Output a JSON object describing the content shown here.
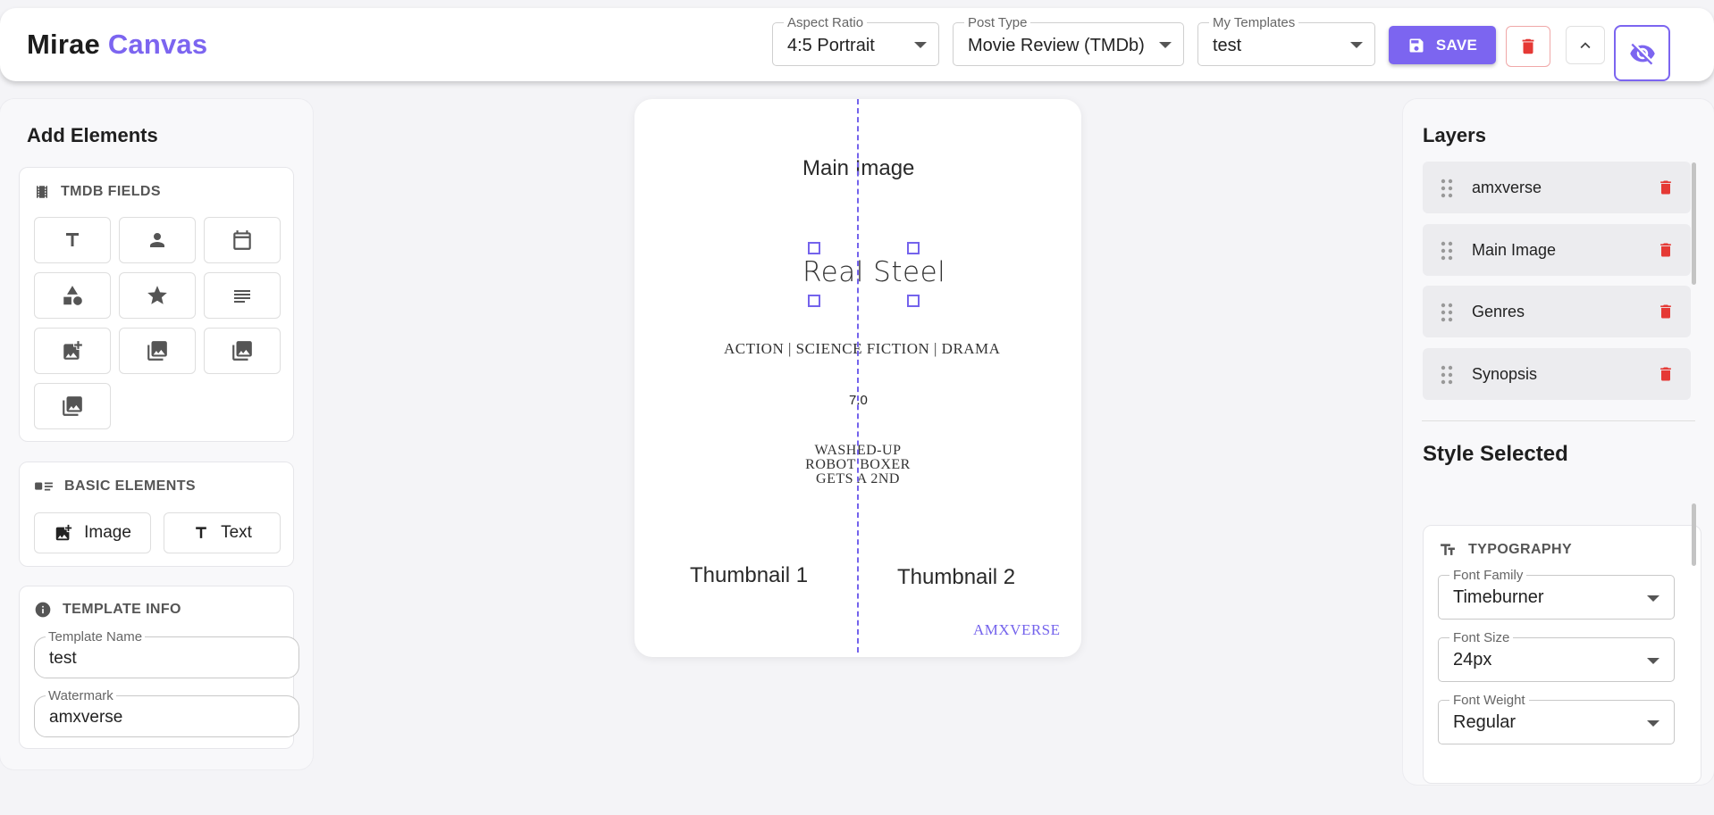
{
  "brand": {
    "name": "Mirae",
    "accent": "Canvas"
  },
  "toolbar": {
    "aspect_ratio": {
      "label": "Aspect Ratio",
      "value": "4:5 Portrait"
    },
    "post_type": {
      "label": "Post Type",
      "value": "Movie Review (TMDb)"
    },
    "templates": {
      "label": "My Templates",
      "value": "test"
    },
    "save_label": "SAVE"
  },
  "left": {
    "title": "Add Elements",
    "tmdb": {
      "header": "TMDB FIELDS",
      "tools": [
        "title-icon",
        "person-icon",
        "calendar-icon",
        "shapes-icon",
        "star-icon",
        "lines-icon",
        "add-photo-icon",
        "image-stack-icon",
        "image-icon",
        "image-stack-2-icon"
      ]
    },
    "basic": {
      "header": "BASIC ELEMENTS",
      "image_label": "Image",
      "text_label": "Text"
    },
    "info": {
      "header": "TEMPLATE INFO",
      "template_name": {
        "label": "Template Name",
        "value": "test"
      },
      "watermark": {
        "label": "Watermark",
        "value": "amxverse"
      }
    }
  },
  "canvas": {
    "main_image": "Main Image",
    "title": "Real Steel",
    "genres": "ACTION | SCIENCE FICTION | DRAMA",
    "rating": "7.0",
    "synopsis": [
      "WASHED-UP",
      "ROBOT BOXER",
      "GETS A 2ND"
    ],
    "thumb1": "Thumbnail 1",
    "thumb2": "Thumbnail 2",
    "watermark": "AMXVERSE"
  },
  "right": {
    "title": "Layers",
    "layers": [
      "amxverse",
      "Main Image",
      "Genres",
      "Synopsis"
    ],
    "style_title": "Style Selected",
    "typography": {
      "header": "TYPOGRAPHY",
      "font_family": {
        "label": "Font Family",
        "value": "Timeburner"
      },
      "font_size": {
        "label": "Font Size",
        "value": "24px"
      },
      "font_weight": {
        "label": "Font Weight",
        "value": "Regular"
      }
    }
  },
  "colors": {
    "accent": "#7c65f0",
    "danger": "#e53935",
    "guide": "#7463ec"
  }
}
